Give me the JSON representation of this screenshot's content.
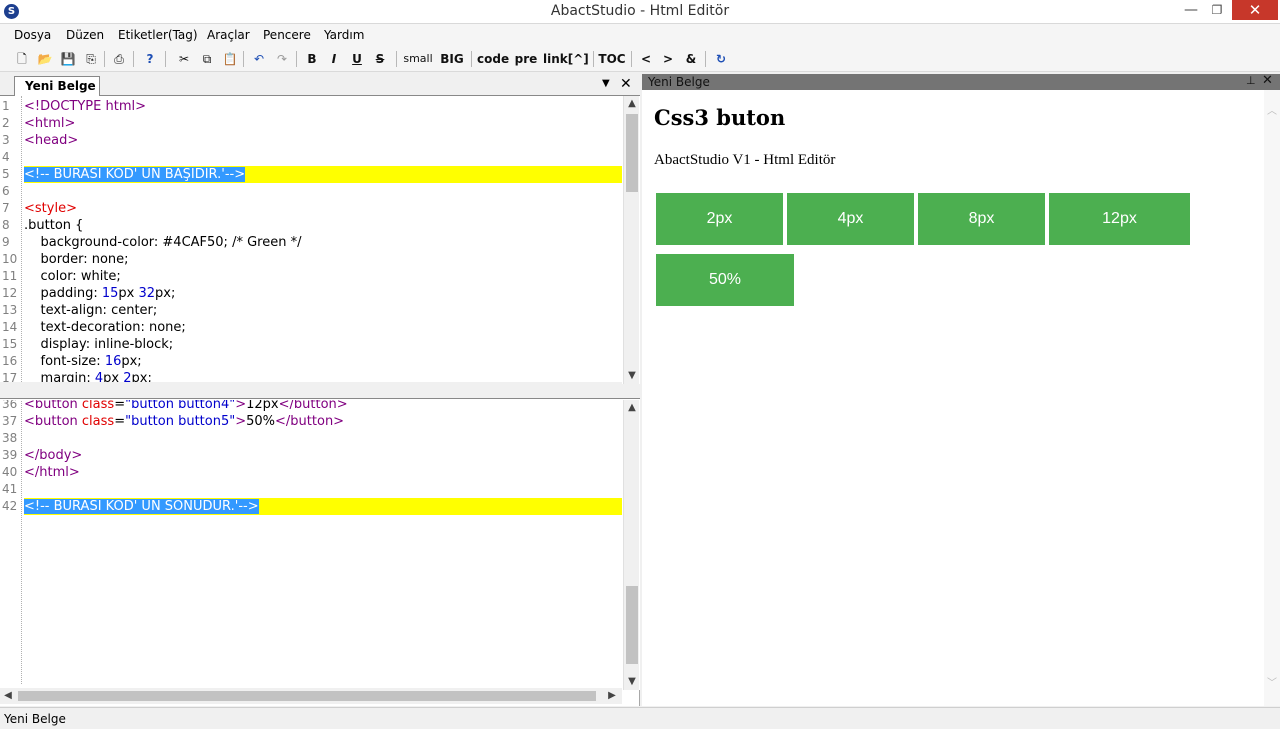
{
  "window": {
    "title": "AbactStudio - Html Editör",
    "icon": "S",
    "min": "—",
    "max": "❐",
    "close": "✕"
  },
  "menu": [
    "Dosya",
    "Düzen",
    "Etiketler(Tag)",
    "Araçlar",
    "Pencere",
    "Yardım"
  ],
  "toolbar": {
    "icons": {
      "new": "🗋",
      "open": "📂",
      "save": "💾",
      "save_all": "⎘",
      "print": "⎙",
      "help": "?",
      "cut": "✂",
      "copy": "⧉",
      "paste": "📋",
      "undo": "↶",
      "redo": "↷",
      "refresh": "↻"
    },
    "bold": "B",
    "italic": "I",
    "underline": "U",
    "strike": "S",
    "small": "small",
    "big": "BIG",
    "code": "code",
    "pre": "pre",
    "link": "link[^]",
    "toc": "TOC",
    "lt": "<",
    "gt": ">",
    "amp": "&"
  },
  "editor": {
    "tab_label": "Yeni Belge *",
    "tab_dropdown": "▼",
    "tab_close": "✕",
    "top_lines": [
      {
        "n": "1",
        "parts": [
          [
            "tag",
            "<!DOCTYPE html>"
          ]
        ]
      },
      {
        "n": "2",
        "parts": [
          [
            "tag",
            "<html>"
          ]
        ]
      },
      {
        "n": "3",
        "parts": [
          [
            "tag",
            "<head>"
          ]
        ]
      },
      {
        "n": "4",
        "parts": []
      },
      {
        "n": "5",
        "parts": [
          [
            "sel",
            "<!-- BURASI KOD' UN BAŞIDIR.'-->"
          ]
        ],
        "hl": true
      },
      {
        "n": "6",
        "parts": []
      },
      {
        "n": "7",
        "parts": [
          [
            "red",
            "<style>"
          ]
        ]
      },
      {
        "n": "8",
        "parts": [
          [
            "txt",
            ".button {"
          ]
        ]
      },
      {
        "n": "9",
        "parts": [
          [
            "txt",
            "    background-color: #4CAF50; /* Green */"
          ]
        ]
      },
      {
        "n": "10",
        "parts": [
          [
            "txt",
            "    border: none;"
          ]
        ]
      },
      {
        "n": "11",
        "parts": [
          [
            "txt",
            "    color: white;"
          ]
        ]
      },
      {
        "n": "12",
        "parts": [
          [
            "txt",
            "    padding: "
          ],
          [
            "blue",
            "15"
          ],
          [
            "txt",
            "px "
          ],
          [
            "blue",
            "32"
          ],
          [
            "txt",
            "px;"
          ]
        ]
      },
      {
        "n": "13",
        "parts": [
          [
            "txt",
            "    text-align: center;"
          ]
        ]
      },
      {
        "n": "14",
        "parts": [
          [
            "txt",
            "    text-decoration: none;"
          ]
        ]
      },
      {
        "n": "15",
        "parts": [
          [
            "txt",
            "    display: inline-block;"
          ]
        ]
      },
      {
        "n": "16",
        "parts": [
          [
            "txt",
            "    font-size: "
          ],
          [
            "blue",
            "16"
          ],
          [
            "txt",
            "px;"
          ]
        ]
      },
      {
        "n": "17",
        "parts": [
          [
            "txt",
            "    margin: "
          ],
          [
            "blue",
            "4"
          ],
          [
            "txt",
            "px "
          ],
          [
            "blue",
            "2"
          ],
          [
            "txt",
            "px;"
          ]
        ]
      }
    ],
    "bottom_lines": [
      {
        "n": "36",
        "parts": [
          [
            "tag",
            "<button "
          ],
          [
            "red",
            "class"
          ],
          [
            "txt",
            "="
          ],
          [
            "blue",
            "\"button button4\""
          ],
          [
            "tag",
            ">"
          ],
          [
            "txt",
            "12px"
          ],
          [
            "tag",
            "</button>"
          ]
        ]
      },
      {
        "n": "37",
        "parts": [
          [
            "tag",
            "<button "
          ],
          [
            "red",
            "class"
          ],
          [
            "txt",
            "="
          ],
          [
            "blue",
            "\"button button5\""
          ],
          [
            "tag",
            ">"
          ],
          [
            "txt",
            "50%"
          ],
          [
            "tag",
            "</button>"
          ]
        ]
      },
      {
        "n": "38",
        "parts": []
      },
      {
        "n": "39",
        "parts": [
          [
            "tag",
            "</body>"
          ]
        ]
      },
      {
        "n": "40",
        "parts": [
          [
            "tag",
            "</html>"
          ]
        ]
      },
      {
        "n": "41",
        "parts": []
      },
      {
        "n": "42",
        "parts": [
          [
            "sel",
            "<!-- BURASI KOD' UN SONUDUR.'-->"
          ]
        ],
        "hl": true
      }
    ]
  },
  "preview": {
    "title": "Yeni Belge",
    "pin": "⊥",
    "close": "✕",
    "heading": "Css3 buton",
    "paragraph": "AbactStudio V1 - Html Editör",
    "button_color": "#4CAF50",
    "buttons": [
      "2px",
      "4px",
      "8px",
      "12px",
      "50%"
    ]
  },
  "status": "Yeni Belge"
}
